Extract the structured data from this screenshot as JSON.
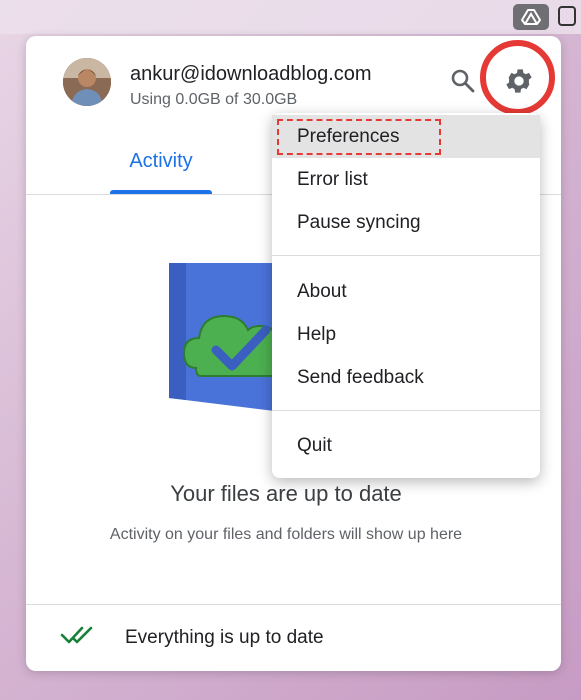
{
  "account": {
    "email": "ankur@idownloadblog.com",
    "usage": "Using 0.0GB of 30.0GB"
  },
  "header": {
    "search_icon": "search-icon",
    "settings_icon": "gear-icon"
  },
  "tabs": [
    {
      "label": "Activity",
      "active": true
    }
  ],
  "empty_state": {
    "title": "Your files are up to date",
    "subtitle": "Activity on your files and folders will show up here"
  },
  "footer": {
    "status": "Everything is up to date"
  },
  "menu": {
    "items": [
      {
        "label": "Preferences",
        "highlighted": true
      },
      {
        "label": "Error list"
      },
      {
        "label": "Pause syncing"
      },
      {
        "label": "About"
      },
      {
        "label": "Help"
      },
      {
        "label": "Send feedback"
      },
      {
        "label": "Quit"
      }
    ]
  },
  "colors": {
    "accent": "#1a73e8",
    "annotation_red": "#e53935",
    "status_green": "#188038"
  }
}
